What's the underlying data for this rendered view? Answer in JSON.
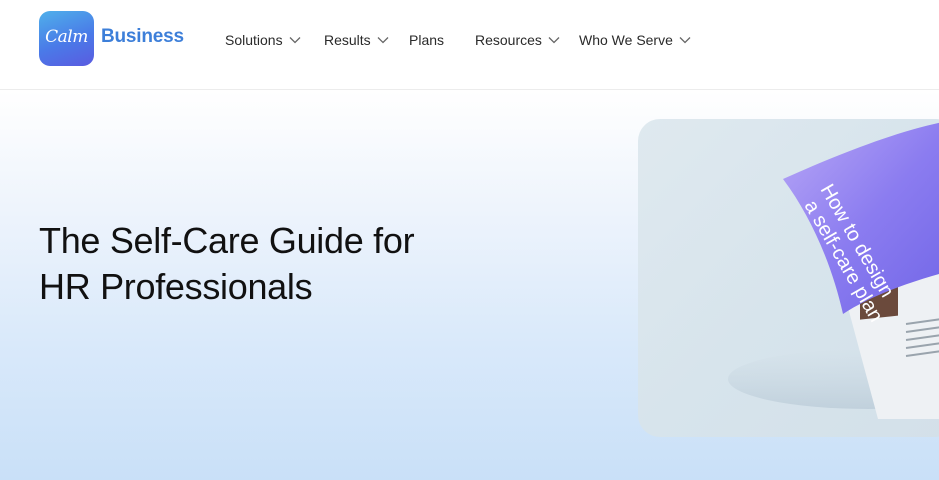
{
  "logo": {
    "mark": "Calm",
    "brand": "Business"
  },
  "nav": {
    "items": [
      {
        "label": "Solutions",
        "has_dropdown": true
      },
      {
        "label": "Results",
        "has_dropdown": true
      },
      {
        "label": "Plans",
        "has_dropdown": false
      },
      {
        "label": "Resources",
        "has_dropdown": true
      },
      {
        "label": "Who We Serve",
        "has_dropdown": true
      }
    ]
  },
  "hero": {
    "title_line1": "The Self-Care Guide for",
    "title_line2": "HR Professionals",
    "image": {
      "cover_line1": "How to design",
      "cover_line2": "a self-care plan"
    }
  },
  "colors": {
    "brand_blue": "#3d7fd9",
    "logo_gradient_start": "#4fb0ea",
    "logo_gradient_end": "#5a5be0",
    "booklet_purple": "#8b7cf0"
  }
}
